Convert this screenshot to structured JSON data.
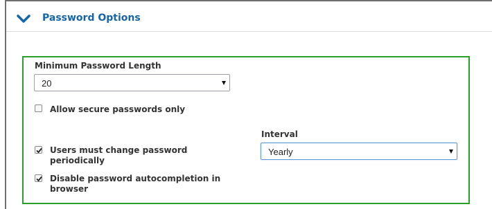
{
  "section": {
    "title": "Password Options",
    "icon": "chevron-down-icon",
    "accent_color": "#1565a8"
  },
  "options_box": {
    "border_color": "#27a12a"
  },
  "min_length": {
    "label": "Minimum Password Length",
    "value": "20"
  },
  "secure_only": {
    "label": "Allow secure passwords only",
    "checked": false
  },
  "change_periodically": {
    "label_line1": "Users must change password",
    "label_line2": "periodically",
    "checked": true
  },
  "disable_autocompletion": {
    "label_line1": "Disable password autocompletion in",
    "label_line2": "browser",
    "checked": true
  },
  "interval": {
    "label": "Interval",
    "value": "Yearly"
  }
}
